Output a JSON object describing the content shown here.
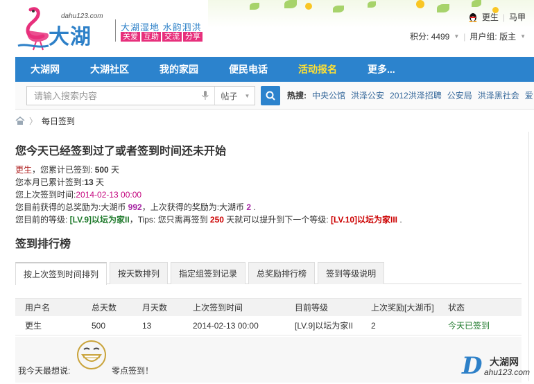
{
  "header": {
    "logo_domain": "dahu123.com",
    "logo_name": "大湖网",
    "slogan_line1": "大湖湿地  水韵泗洪",
    "slogan_tags": [
      "关爱",
      "互助",
      "交流",
      "分享"
    ],
    "username": "更生",
    "other_user": "马甲",
    "points_label": "积分: 4499",
    "group_label": "用户组: 版主"
  },
  "nav": {
    "items": [
      "大湖网",
      "大湖社区",
      "我的家园",
      "便民电话",
      "活动报名",
      "更多..."
    ],
    "active_index": 4
  },
  "search": {
    "placeholder": "请输入搜索内容",
    "type": "帖子",
    "hot_label": "热搜:",
    "hot_words": [
      "中央公馆",
      "洪泽公安",
      "2012洪泽招聘",
      "公安局",
      "洪泽黑社会",
      "爱"
    ]
  },
  "breadcrumb": {
    "current": "每日签到"
  },
  "message": "您今天已经签到过了或者签到时间还未开始",
  "info": {
    "name": "更生",
    "total_prefix": "，您累计已签到: ",
    "total_days": "500",
    "day_unit": " 天",
    "month_prefix": "您本月已累计签到:",
    "month_days": "13",
    "month_unit": " 天",
    "last_prefix": "您上次签到时间:",
    "last_time": "2014-02-13 00:00",
    "reward_prefix": "您目前获得的总奖励为:大湖币 ",
    "reward_total": "992",
    "reward_mid": "，上次获得的奖励为:大湖币 ",
    "reward_last": "2",
    "reward_end": " .",
    "level_prefix": "您目前的等级: ",
    "level_current": "[LV.9]以坛为家II",
    "level_mid": "，Tips: 您只需再签到 ",
    "level_days": "250",
    "level_mid2": " 天就可以提升到下一个等级: ",
    "level_next": "[LV.10]以坛为家III",
    "level_end": " ."
  },
  "ranking": {
    "title": "签到排行榜",
    "tabs": [
      "按上次签到时间排列",
      "按天数排列",
      "指定组签到记录",
      "总奖励排行榜",
      "签到等级说明"
    ],
    "active_tab": 0,
    "columns": [
      "用户名",
      "总天数",
      "月天数",
      "上次签到时间",
      "目前等级",
      "上次奖励[大湖币]",
      "状态"
    ],
    "rows": [
      [
        "更生",
        "500",
        "13",
        "2014-02-13 00:00",
        "[LV.9]以坛为家II",
        "2",
        "今天已签到"
      ]
    ]
  },
  "mood": {
    "label": "我今天最想说:",
    "text": "零点签到！"
  },
  "watermark": {
    "letter": "D",
    "name": "大湖网",
    "domain": "ahu123.com"
  },
  "colors": {
    "nav_bg": "#2c83cd",
    "nav_active": "#ffe033",
    "brand": "#2d80c8",
    "slogan_tag": "#e7307c"
  }
}
